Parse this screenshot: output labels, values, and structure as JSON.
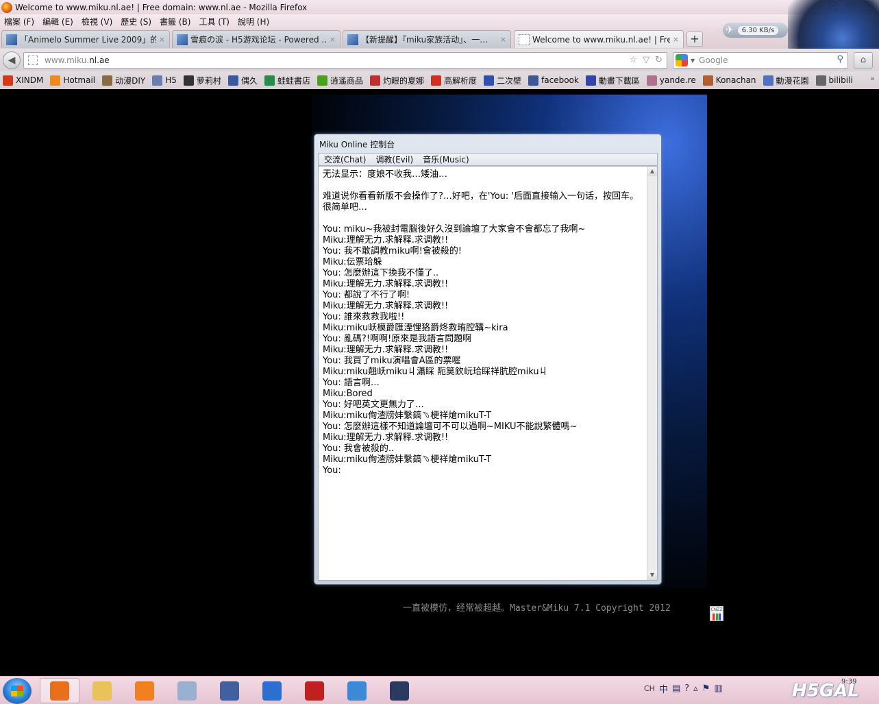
{
  "window": {
    "title": "Welcome to www.miku.nl.ae! | Free domain: www.nl.ae - Mozilla Firefox",
    "controls": [
      "−",
      "□",
      "×"
    ]
  },
  "menu": [
    "檔案 (F)",
    "編輯 (E)",
    "檢視 (V)",
    "歷史 (S)",
    "書籤 (B)",
    "工具 (T)",
    "說明 (H)"
  ],
  "tabs": [
    {
      "label": "「Animelo Summer Live 2009」的…",
      "close": "×"
    },
    {
      "label": "雪痕の涙 - H5游戏论坛 - Powered …",
      "close": "×"
    },
    {
      "label": "【新提醒】『miku家族活动』、一…",
      "close": "×"
    },
    {
      "label": "Welcome to www.miku.nl.ae! | Fre…",
      "close": "×"
    }
  ],
  "new_tab": "+",
  "speed": "6.30 KB/s",
  "nav": {
    "url_prefix": "www.miku.",
    "url_domain": "nl.ae",
    "search_placeholder": "Google"
  },
  "bookmarks": [
    {
      "label": "XINDM",
      "color": "#d43a1a"
    },
    {
      "label": "Hotmail",
      "color": "#f08a1a"
    },
    {
      "label": "动漫DIY",
      "color": "#8a6a40"
    },
    {
      "label": "H5",
      "color": "#6a7fb0"
    },
    {
      "label": "萝莉村",
      "color": "#333333"
    },
    {
      "label": "偶久",
      "color": "#3a5aa0"
    },
    {
      "label": "蛙蛙書店",
      "color": "#2a8a4a"
    },
    {
      "label": "逍遙商品",
      "color": "#4aa020"
    },
    {
      "label": "灼眼的夏娜",
      "color": "#c03030"
    },
    {
      "label": "高解析度",
      "color": "#d03020"
    },
    {
      "label": "二次壁",
      "color": "#3050b0"
    },
    {
      "label": "facebook",
      "color": "#3b5998"
    },
    {
      "label": "動畫下載區",
      "color": "#3344aa"
    },
    {
      "label": "yande.re",
      "color": "#b07090"
    },
    {
      "label": "Konachan",
      "color": "#b06030"
    },
    {
      "label": "動漫花園",
      "color": "#5070c0"
    },
    {
      "label": "bilibili",
      "color": "#666666"
    }
  ],
  "bookmarks_more": "»",
  "console": {
    "title": "Miku Online 控制台",
    "menu": [
      "交流(Chat)",
      "调教(Evil)",
      "音乐(Music)"
    ],
    "lines": [
      "无法显示：度娘不收我…矮油…",
      "",
      "难道说你看看新版不会操作了?…好吧，在'You: '后面直接输入一句话，按回车。很简单吧…",
      "",
      "You: miku~我被封電腦後好久沒到論壇了大家會不會都忘了我啊~",
      "Miku:理解无力.求解释.求调教!!",
      "You: 我不敢調教miku啊!會被殺的!",
      "Miku:伝票珨躲",
      "You: 怎麼辦這下換我不懂了..",
      "Miku:理解无力.求解释.求调教!!",
      "You: 都說了不行了啊!",
      "Miku:理解无力.求解释.求调教!!",
      "You: 誰來救救我啦!!",
      "Miku:miku岆模爵匯湮悝狢爵炵救珛腔鞲~kira",
      "You: 亂碼?!啊啊!原來是我語言問題啊",
      "Miku:理解无力.求解释.求调教!!",
      "You: 我買了miku演唱會A區的票喔",
      "Miku:miku翹岆miku丩瀟睬    阨筽欽岏珨睬祥肮腔miku丩",
      "You: 語言啊…",
      "Miku:Bored",
      "You: 好吧英文更無力了…",
      "Miku:miku侚渣牓妦繫鎬﹆梗祥熗mikuT-T",
      "You: 怎麼辦這樣不知道論壇可不可以過啊~MIKU不能說繁體嗎~",
      "Miku:理解无力.求解释.求调教!!",
      "You: 我會被殺的..",
      "Miku:miku侚渣牓妦繫鎬﹆梗祥熗mikuT-T",
      "You:"
    ]
  },
  "footer": "一直被模仿，经常被超越。Master&Miku 7.1 Copyright 2012",
  "cnzz": "CNZZ",
  "taskbar": {
    "items": [
      {
        "name": "firefox",
        "color": "#e8701a",
        "active": true
      },
      {
        "name": "explorer",
        "color": "#e9c35a",
        "active": false
      },
      {
        "name": "media-player",
        "color": "#f08020",
        "active": false
      },
      {
        "name": "paint",
        "color": "#9ab0d0",
        "active": false
      },
      {
        "name": "app-15",
        "color": "#4060a0",
        "active": false
      },
      {
        "name": "app-k",
        "color": "#2c6fd0",
        "active": false
      },
      {
        "name": "app-red",
        "color": "#c02020",
        "active": false
      },
      {
        "name": "app-bird",
        "color": "#3a8ad8",
        "active": false
      },
      {
        "name": "league",
        "color": "#2a3a60",
        "active": false
      }
    ],
    "tray": [
      "CH",
      "中"
    ],
    "clock": "9:39",
    "brand": "H5GAL"
  }
}
